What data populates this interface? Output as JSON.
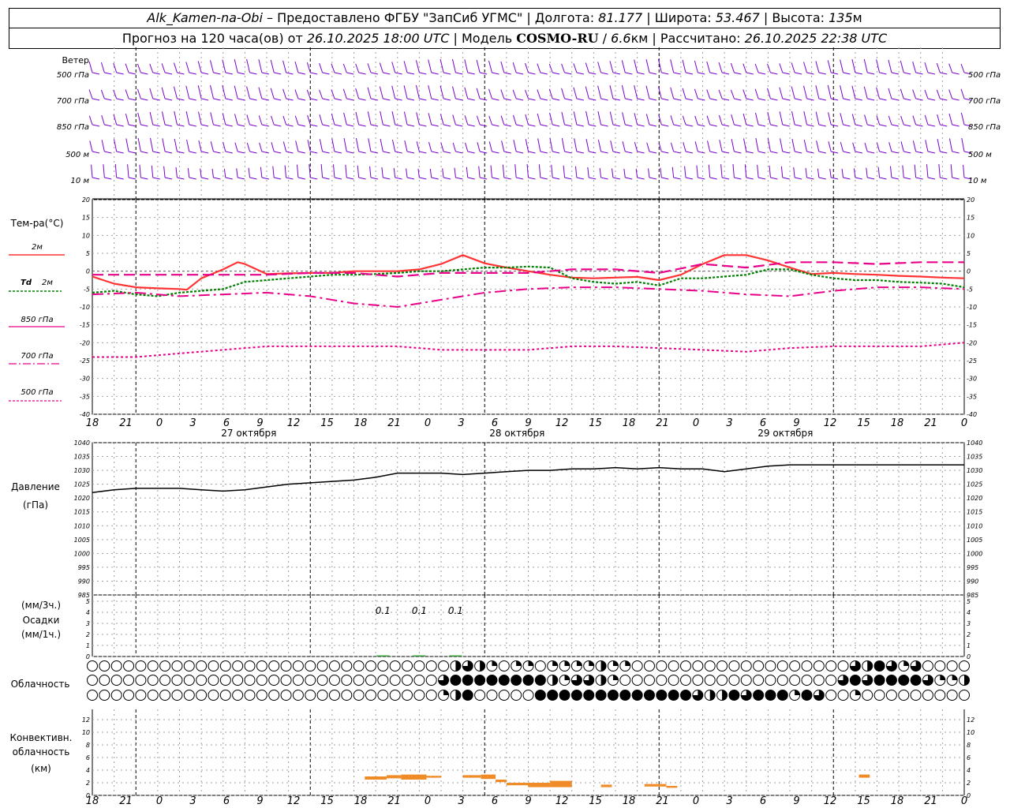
{
  "header": {
    "station": "Alk_Kamen-na-Obi",
    "provider": " – Предоставлено ФГБУ \"ЗапСиб УГМС\" | Долгота: ",
    "lon": "81.177",
    "lat_label": " | Широта: ",
    "lat": "53.467",
    "alt_label": " | Высота: ",
    "alt": "135",
    "alt_unit": "м",
    "forecast_prefix": "Прогноз на 120 часа(ов) от ",
    "forecast_from": "26.10.2025 18:00 UTC",
    "model_prefix": " | Модель ",
    "model": "COSMO-RU",
    "model_res_sep": " / ",
    "model_res": "6.6",
    "model_res_unit": "км",
    "calc_label": " | Рассчитано: ",
    "calc_time": "26.10.2025 22:38 UTC"
  },
  "labels": {
    "wind": "Ветер",
    "lvl500": "500 гПа",
    "lvl700": "700 гПа",
    "lvl850": "850 гПа",
    "lvl500m": "500 м",
    "lvl10m": "10  м",
    "temp_title": "Тем-ра(°C)",
    "leg_2m": "2м",
    "leg_td": "Td",
    "leg_td2": "2м",
    "leg_850": "850 гПа",
    "leg_700": "700 гПа",
    "leg_500": "500 гПа",
    "pressure1": "Давление",
    "pressure2": "(гПа)",
    "precip1": "(мм/3ч.)",
    "precip2": "Осадки",
    "precip3": "(мм/1ч.)",
    "cloud": "Облачность",
    "conv1": "Конвективн.",
    "conv2": "облачность",
    "conv3": "(км)"
  },
  "colors": {
    "t2m": "#ff3333",
    "td2m": "#008000",
    "t850": "#e8008a",
    "t700": "#e8008a",
    "t500": "#e8008a",
    "wind": "#7a00cc",
    "conv": "#f08c28",
    "grid": "#a0a0a0"
  },
  "chart_data": [
    {
      "type": "wind_barbs",
      "levels": [
        "500 гПа",
        "700 гПа",
        "850 гПа",
        "500 м",
        "10  м"
      ],
      "hours": [
        0,
        120
      ],
      "direction_note_deg": {
        "500 гПа": 250,
        "700 гПа": 250,
        "850 гПа": 240,
        "500 м": 230,
        "10  м": 200
      }
    },
    {
      "type": "line",
      "title": "Тем-ра(°C)",
      "ylim": [
        -40,
        20
      ],
      "yticks": [
        -40,
        -35,
        -30,
        -25,
        -20,
        -15,
        -10,
        -5,
        0,
        5,
        10,
        15,
        20
      ],
      "xlim": [
        0,
        120
      ],
      "x_tick_labels": [
        "18",
        "21",
        "0",
        "3",
        "6",
        "9",
        "12",
        "15",
        "18",
        "21",
        "0",
        "3",
        "6",
        "9",
        "12",
        "15",
        "18",
        "21",
        "0",
        "3",
        "6",
        "9",
        "12",
        "15",
        "18",
        "21",
        "0"
      ],
      "day_labels": [
        {
          "hour": 21,
          "text": "27 октября"
        },
        {
          "hour": 57,
          "text": "28 октября"
        },
        {
          "hour": 93,
          "text": "29 октября"
        }
      ],
      "series": [
        {
          "name": "2м",
          "x": [
            0,
            3,
            6,
            9,
            12,
            13,
            15,
            18,
            20,
            21,
            24,
            27,
            30,
            33,
            36,
            39,
            42,
            45,
            48,
            51,
            54,
            57,
            60,
            63,
            66,
            69,
            72,
            75,
            78,
            81,
            84,
            87,
            90,
            93,
            96,
            99,
            102,
            105,
            108,
            111,
            114,
            117,
            120
          ],
          "y": [
            -1.5,
            -3.5,
            -4.5,
            -4.8,
            -5,
            -5.2,
            -2,
            0.5,
            2.5,
            2,
            -0.8,
            -0.6,
            -0.5,
            -0.5,
            0,
            0,
            0,
            0.5,
            2,
            4.5,
            2.2,
            1,
            0,
            -1,
            -1.8,
            -2,
            -1.8,
            -1.6,
            -2.5,
            -1,
            2,
            4.5,
            4.5,
            3,
            1,
            -0.8,
            -0.5,
            -0.8,
            -1,
            -1.3,
            -1.5,
            -1.8,
            -2
          ]
        },
        {
          "name": "Td 2м",
          "x": [
            0,
            3,
            6,
            9,
            12,
            15,
            18,
            21,
            24,
            27,
            30,
            33,
            36,
            39,
            42,
            45,
            48,
            51,
            54,
            57,
            60,
            63,
            66,
            69,
            72,
            75,
            78,
            81,
            84,
            87,
            90,
            93,
            96,
            99,
            102,
            105,
            108,
            111,
            114,
            117,
            120
          ],
          "y": [
            -6,
            -5.5,
            -6.5,
            -7,
            -6,
            -5.5,
            -5,
            -3,
            -2.5,
            -2,
            -1.5,
            -1,
            -1,
            -0.8,
            -0.5,
            0,
            0,
            0.5,
            1,
            1,
            1.3,
            1,
            -2,
            -3,
            -3.5,
            -3,
            -4,
            -2,
            -2,
            -1.5,
            -1,
            0.5,
            0.5,
            -1,
            -2,
            -2.5,
            -2.5,
            -3,
            -3.2,
            -3.5,
            -4.5
          ]
        },
        {
          "name": "850 гПа",
          "x": [
            0,
            6,
            12,
            18,
            24,
            30,
            36,
            42,
            48,
            54,
            60,
            66,
            72,
            78,
            84,
            90,
            96,
            102,
            108,
            114,
            120
          ],
          "y": [
            -1,
            -1,
            -1,
            -1,
            -1,
            -0.5,
            -0.5,
            -1.5,
            -0.5,
            -0.5,
            -0.5,
            0.5,
            0.5,
            -0.5,
            2,
            1,
            2.5,
            2.5,
            2,
            2.5,
            2.5
          ]
        },
        {
          "name": "700 гПа",
          "x": [
            0,
            6,
            12,
            18,
            24,
            30,
            36,
            42,
            48,
            54,
            60,
            66,
            72,
            78,
            84,
            90,
            96,
            102,
            108,
            114,
            120
          ],
          "y": [
            -6.5,
            -6,
            -7,
            -6.5,
            -6,
            -7,
            -9,
            -10,
            -8,
            -6,
            -5,
            -4.5,
            -4.5,
            -5,
            -5.5,
            -6.5,
            -7,
            -5.5,
            -4.5,
            -4.5,
            -5
          ]
        },
        {
          "name": "500 гПа",
          "x": [
            0,
            6,
            12,
            18,
            24,
            30,
            36,
            42,
            48,
            54,
            60,
            66,
            72,
            78,
            84,
            90,
            96,
            102,
            108,
            114,
            120
          ],
          "y": [
            -24,
            -24,
            -23,
            -22,
            -21,
            -21,
            -21,
            -21,
            -22,
            -22,
            -22,
            -21,
            -21,
            -21.5,
            -22,
            -22.5,
            -21.5,
            -21,
            -21,
            -21,
            -20
          ]
        }
      ]
    },
    {
      "type": "line",
      "title": "Давление",
      "ylabel": "(гПа)",
      "ylim": [
        985,
        1040
      ],
      "yticks": [
        985,
        990,
        995,
        1000,
        1005,
        1010,
        1015,
        1020,
        1025,
        1030,
        1035,
        1040
      ],
      "xlim": [
        0,
        120
      ],
      "series": [
        {
          "name": "Давление",
          "x": [
            0,
            3,
            6,
            9,
            12,
            15,
            18,
            21,
            24,
            27,
            30,
            33,
            36,
            39,
            42,
            45,
            48,
            51,
            54,
            57,
            60,
            63,
            66,
            69,
            72,
            75,
            78,
            81,
            84,
            87,
            90,
            93,
            96,
            99,
            102,
            105,
            108,
            111,
            114,
            117,
            120
          ],
          "y": [
            1022,
            1023,
            1023.5,
            1023.5,
            1023.5,
            1023,
            1022.5,
            1023,
            1024,
            1025,
            1025.5,
            1026,
            1026.5,
            1027.5,
            1029,
            1029,
            1029,
            1028.5,
            1029,
            1029.5,
            1030,
            1030,
            1030.5,
            1030.5,
            1031,
            1030.5,
            1031,
            1030.5,
            1030.5,
            1029.5,
            1030.5,
            1031.5,
            1032,
            1032,
            1032,
            1032,
            1032,
            1032,
            1032,
            1032,
            1032
          ]
        }
      ]
    },
    {
      "type": "bar",
      "title": "Осадки",
      "ylim": [
        0,
        5
      ],
      "yticks": [
        0,
        1,
        2,
        3,
        4,
        5
      ],
      "data_labels": [
        {
          "hour": 40,
          "text": "0.1"
        },
        {
          "hour": 45,
          "text": "0.1"
        },
        {
          "hour": 50,
          "text": "0.1"
        }
      ]
    },
    {
      "type": "table",
      "title": "Облачность",
      "rows": 3,
      "columns": 74,
      "legend": "0 = ясно, 1 = 1/4, 2 = 1/2, 3 = 3/4, 4 = сплошная",
      "cover_rows": [
        "0000000000000000000000000000002321011011112110000000000000000003243130000000000000000000024223344434334",
        "0000000000000000000000000000034444444421332100000000000000000034344443112221000000000000031234231134",
        "0000000000000000000000000000012400000444444444444432243444143001000000000000000000000000000000000000"
      ]
    },
    {
      "type": "bar",
      "title": "Конвективн. облачность",
      "ylabel": "(км)",
      "ylim": [
        0,
        13
      ],
      "yticks": [
        0,
        2,
        4,
        6,
        8,
        10,
        12
      ],
      "segments": [
        {
          "from": 37.5,
          "to": 40.5,
          "base": 2.5,
          "top": 3
        },
        {
          "from": 40.5,
          "to": 42.5,
          "base": 2.7,
          "top": 3.2
        },
        {
          "from": 42.5,
          "to": 46,
          "base": 2.5,
          "top": 3.3
        },
        {
          "from": 46,
          "to": 48,
          "base": 2.8,
          "top": 3.1
        },
        {
          "from": 51,
          "to": 53.5,
          "base": 2.8,
          "top": 3.2
        },
        {
          "from": 53.5,
          "to": 55.5,
          "base": 2.6,
          "top": 3.3
        },
        {
          "from": 55.5,
          "to": 57,
          "base": 2.1,
          "top": 2.5
        },
        {
          "from": 57,
          "to": 60,
          "base": 1.6,
          "top": 2
        },
        {
          "from": 60,
          "to": 63,
          "base": 1.3,
          "top": 2
        },
        {
          "from": 63,
          "to": 66,
          "base": 1.3,
          "top": 2.3
        },
        {
          "from": 70,
          "to": 71.5,
          "base": 1.3,
          "top": 1.7
        },
        {
          "from": 76,
          "to": 79,
          "base": 1.4,
          "top": 1.8
        },
        {
          "from": 79,
          "to": 80.5,
          "base": 1.2,
          "top": 1.5
        },
        {
          "from": 105.5,
          "to": 107,
          "base": 2.8,
          "top": 3.3
        }
      ]
    }
  ]
}
